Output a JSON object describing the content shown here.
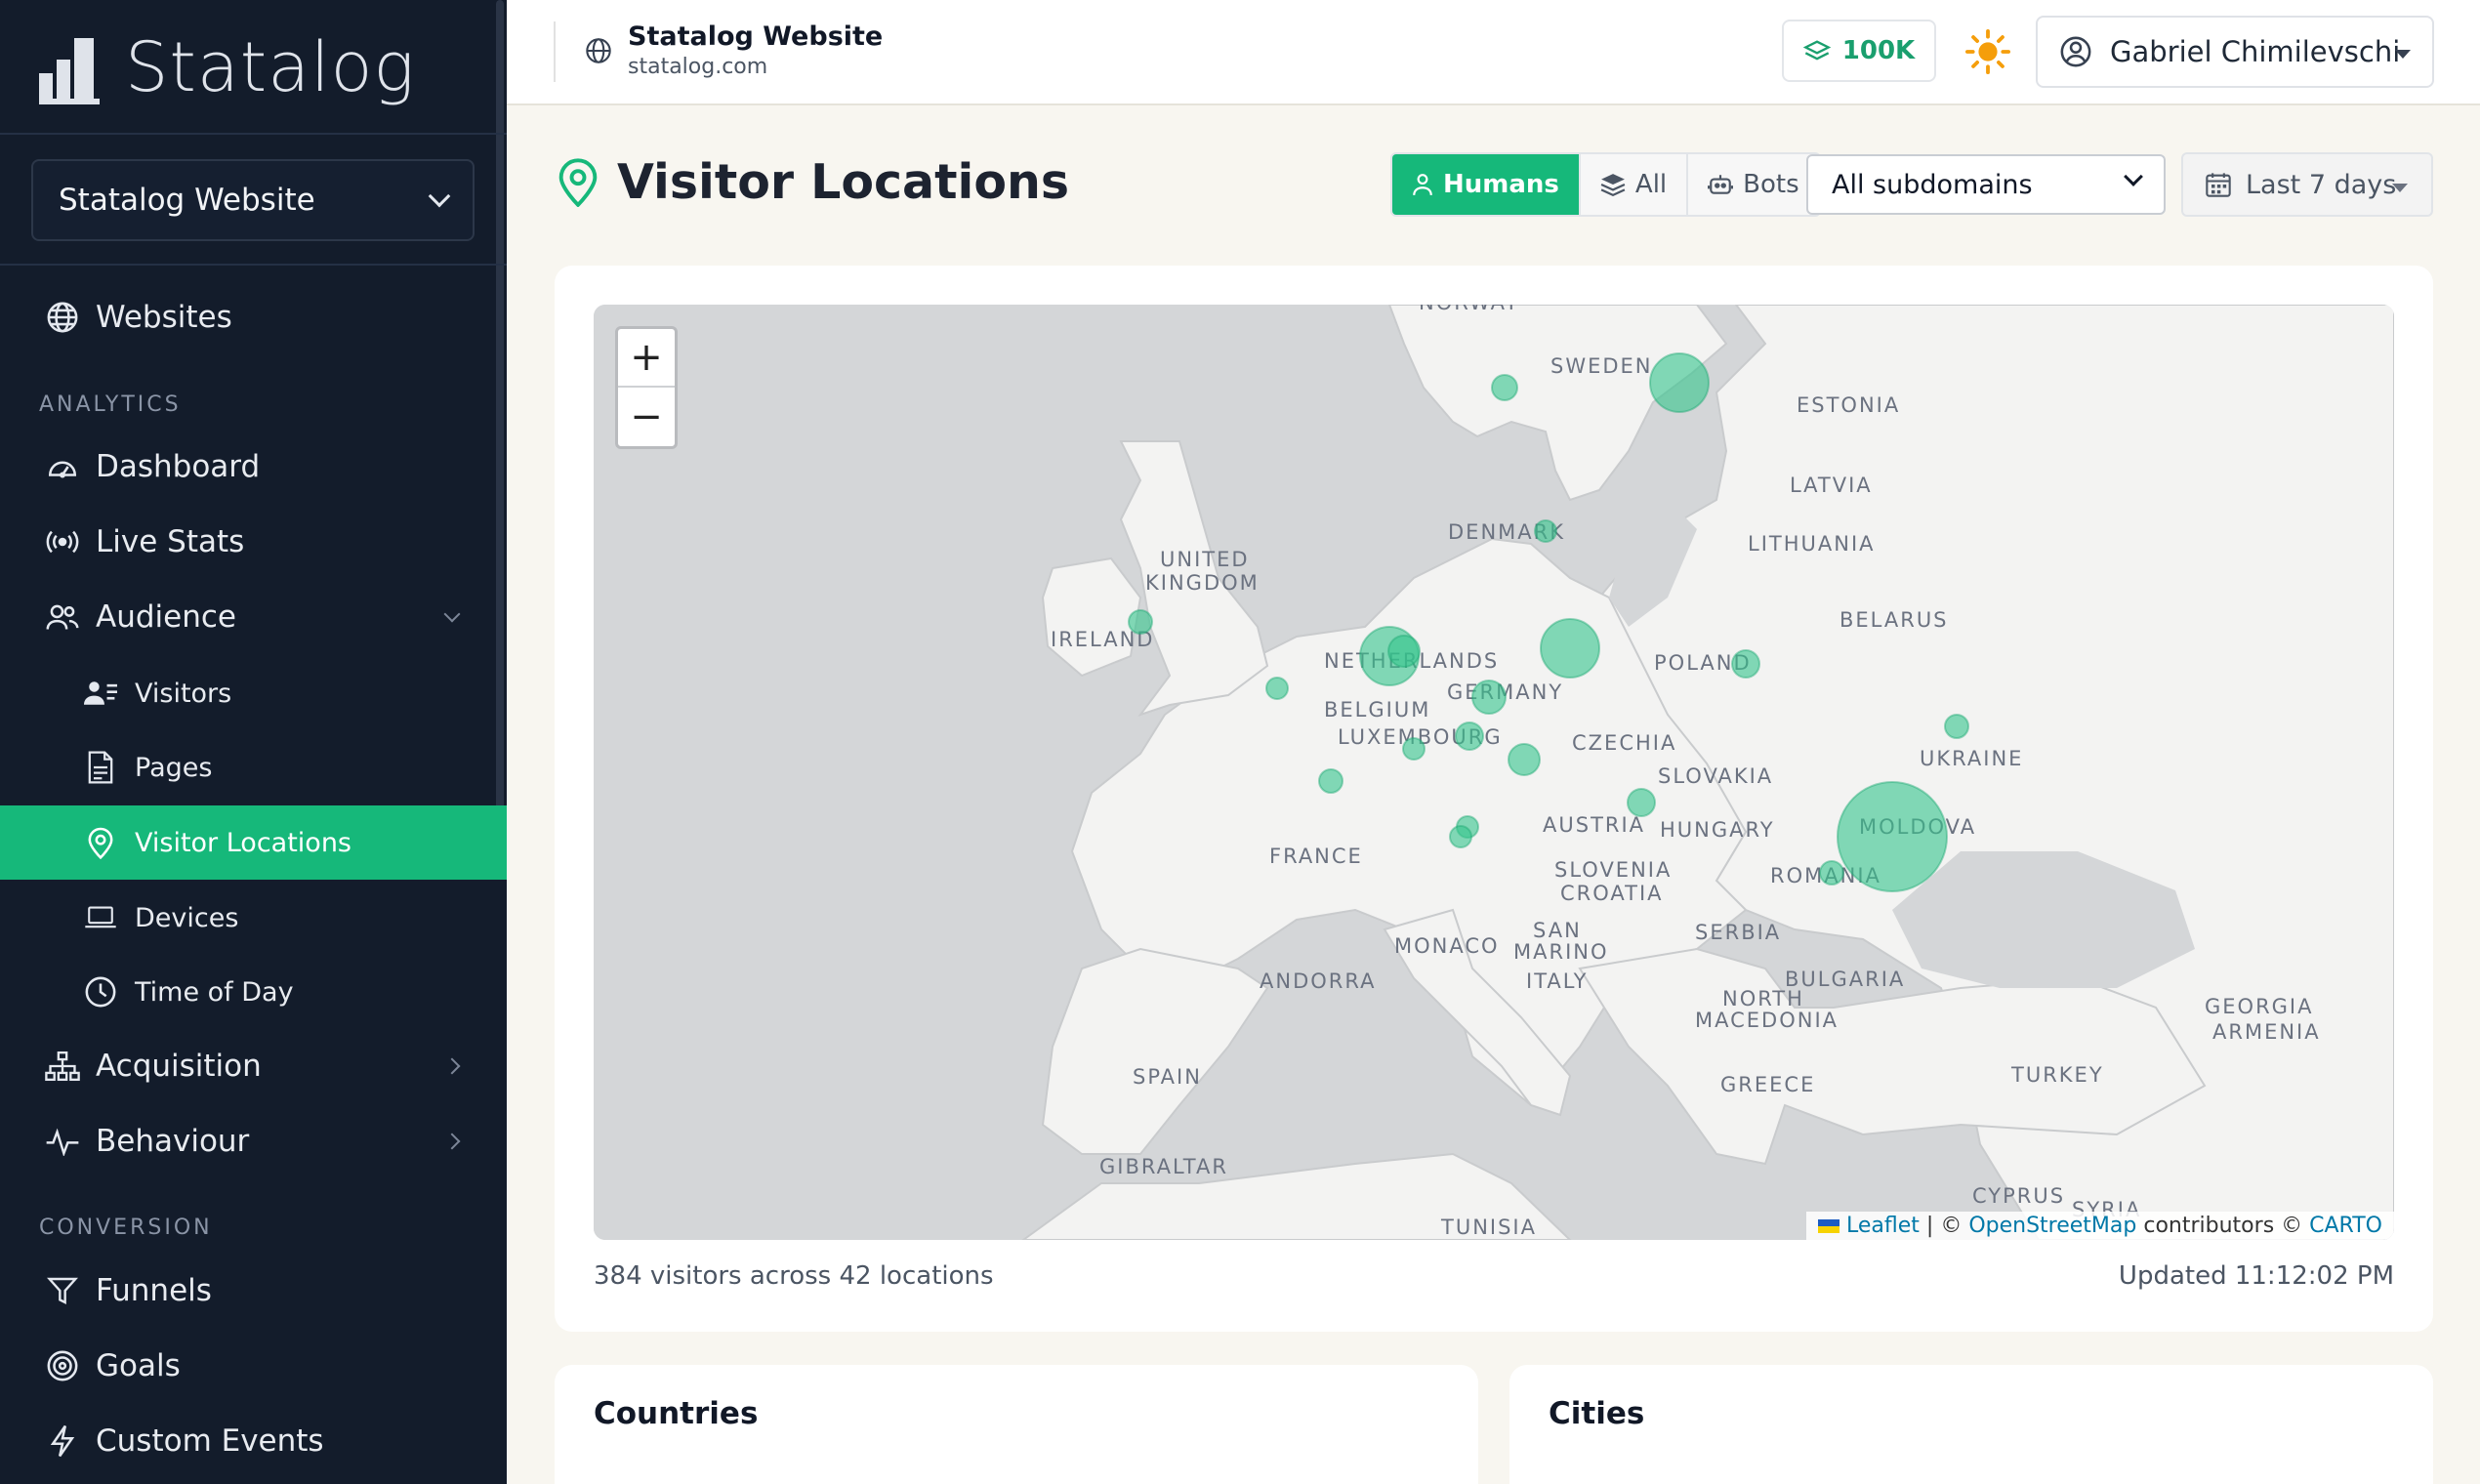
{
  "brand": {
    "name": "Statalog"
  },
  "sidebar": {
    "site_selector": "Statalog Website",
    "items": {
      "websites": "Websites",
      "dashboard": "Dashboard",
      "live_stats": "Live Stats",
      "audience": "Audience",
      "visitors": "Visitors",
      "pages": "Pages",
      "visitor_locations": "Visitor Locations",
      "devices": "Devices",
      "time_of_day": "Time of Day",
      "acquisition": "Acquisition",
      "behaviour": "Behaviour",
      "funnels": "Funnels",
      "goals": "Goals",
      "custom_events": "Custom Events"
    },
    "sections": {
      "analytics": "ANALYTICS",
      "conversion": "CONVERSION"
    }
  },
  "topbar": {
    "site_title": "Statalog Website",
    "site_domain": "statalog.com",
    "credits": "100K",
    "user_name": "Gabriel Chimilevschi"
  },
  "page": {
    "title": "Visitor Locations",
    "filters": {
      "humans": "Humans",
      "all": "All",
      "bots": "Bots"
    },
    "subdomain_select": "All subdomains",
    "date_range": "Last 7 days"
  },
  "map": {
    "zoom_in": "+",
    "zoom_out": "−",
    "attribution": {
      "leaflet": "Leaflet",
      "sep": " | © ",
      "osm": "OpenStreetMap",
      "contrib": " contributors © ",
      "carto": "CARTO"
    },
    "countries": {
      "norway": "NORWAY",
      "sweden": "SWEDEN",
      "estonia": "ESTONIA",
      "latvia": "LATVIA",
      "denmark": "DENMARK",
      "lithuania": "LITHUANIA",
      "uk1": "UNITED",
      "uk2": "KINGDOM",
      "ireland": "IRELAND",
      "belarus": "BELARUS",
      "netherlands": "NETHERLANDS",
      "poland": "POLAND",
      "germany": "GERMANY",
      "belgium": "BELGIUM",
      "luxembourg": "LUXEMBOURG",
      "czechia": "CZECHIA",
      "ukraine": "UKRAINE",
      "slovakia": "SLOVAKIA",
      "austria": "AUSTRIA",
      "hungary": "HUNGARY",
      "moldova": "MOLDOVA",
      "france": "FRANCE",
      "slovenia": "SLOVENIA",
      "croatia": "CROATIA",
      "romania": "ROMANIA",
      "san1": "SAN",
      "san2": "MARINO",
      "serbia": "SERBIA",
      "monaco": "MONACO",
      "andorra": "ANDORRA",
      "italy": "ITALY",
      "bulgaria": "BULGARIA",
      "nm1": "NORTH",
      "nm2": "MACEDONIA",
      "georgia": "GEORGIA",
      "armenia": "ARMENIA",
      "spain": "SPAIN",
      "turkey": "TURKEY",
      "greece": "GREECE",
      "gibraltar": "GIBRALTAR",
      "cyprus": "CYPRUS",
      "syria": "SYRIA",
      "tunisia": "TUNISIA"
    },
    "accent": "#16b87a",
    "summary": "384 visitors across 42 locations",
    "updated": "Updated 11:12:02 PM"
  },
  "cards": {
    "countries": "Countries",
    "cities": "Cities"
  }
}
